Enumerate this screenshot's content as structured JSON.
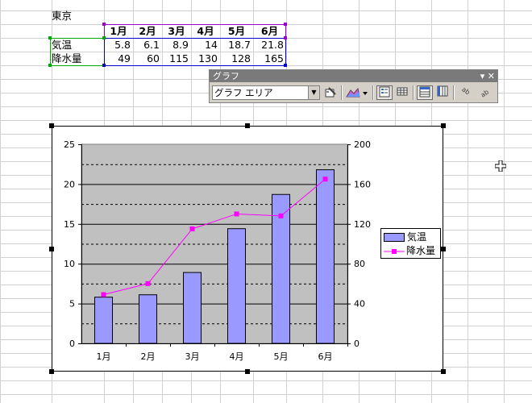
{
  "sheet": {
    "title": "東京",
    "months": [
      "1月",
      "2月",
      "3月",
      "4月",
      "5月",
      "6月"
    ],
    "rows": [
      {
        "label": "気温",
        "values": [
          "5.8",
          "6.1",
          "8.9",
          "14",
          "18.7",
          "21.8"
        ]
      },
      {
        "label": "降水量",
        "values": [
          "49",
          "60",
          "115",
          "130",
          "128",
          "165"
        ]
      }
    ]
  },
  "toolbar": {
    "title": "グラフ",
    "controls": "▾ ✕",
    "chart_object_value": "グラフ エリア",
    "icons": [
      "format-selected-icon",
      "chart-type-icon",
      "legend-icon",
      "data-table-icon",
      "by-row-icon",
      "by-column-icon",
      "angle-text-down-icon",
      "angle-text-up-icon"
    ]
  },
  "chart_data": {
    "type": "bar",
    "categories": [
      "1月",
      "2月",
      "3月",
      "4月",
      "5月",
      "6月"
    ],
    "series": [
      {
        "name": "気温",
        "type": "bar",
        "axis": "left",
        "values": [
          5.8,
          6.1,
          8.9,
          14.4,
          18.7,
          21.8
        ]
      },
      {
        "name": "降水量",
        "type": "line",
        "axis": "right",
        "values": [
          49,
          60,
          115,
          130,
          128,
          165
        ]
      }
    ],
    "ylim_left": [
      0,
      25
    ],
    "ylim_right": [
      0,
      200
    ],
    "yticks_left": [
      "0",
      "5",
      "10",
      "15",
      "20",
      "25"
    ],
    "yticks_right": [
      "0",
      "40",
      "80",
      "120",
      "160",
      "200"
    ],
    "grid": true,
    "legend": "right",
    "colors": {
      "bar": "#9999ff",
      "line": "#ff00ff",
      "plot_bg": "#c0c0c0"
    }
  }
}
